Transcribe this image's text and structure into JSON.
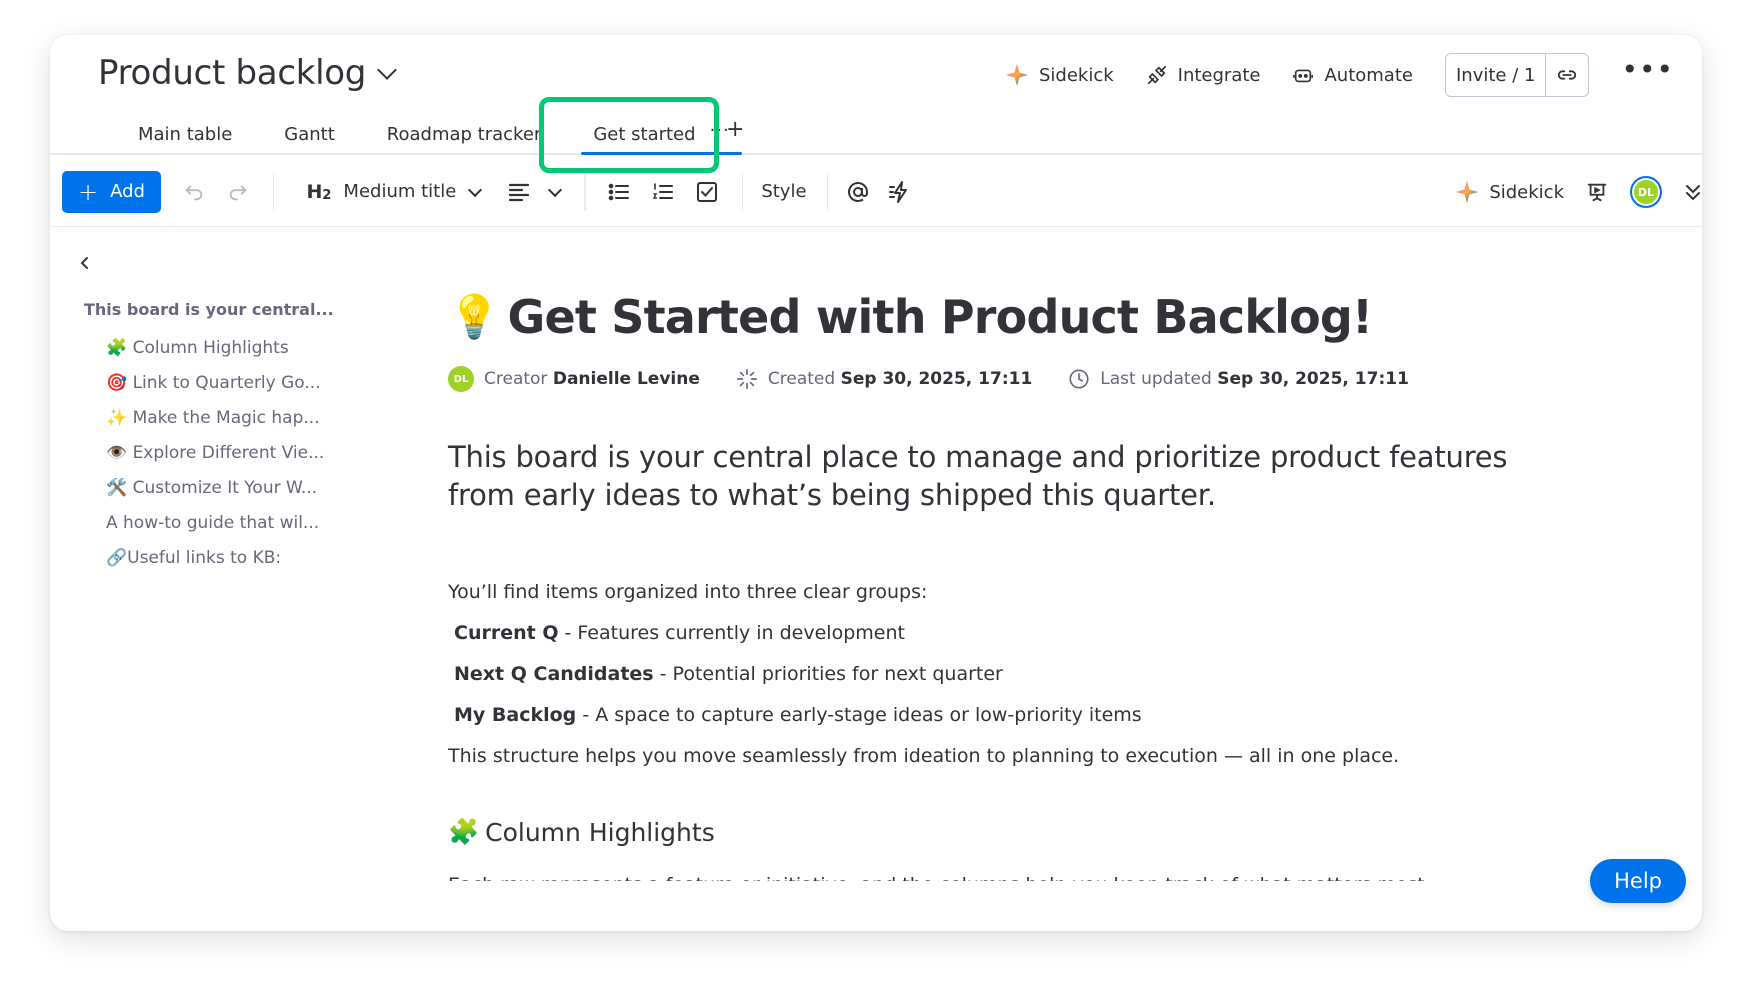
{
  "header": {
    "title": "Product backlog",
    "actions": {
      "sidekick": "Sidekick",
      "integrate": "Integrate",
      "automate": "Automate",
      "invite": "Invite / 1"
    }
  },
  "tabs": [
    {
      "label": "Main table"
    },
    {
      "label": "Gantt"
    },
    {
      "label": "Roadmap tracker"
    },
    {
      "label": "Get started",
      "active": true
    }
  ],
  "toolbar": {
    "add": "Add",
    "heading_level": "H",
    "heading_sub": "2",
    "heading_style": "Medium title",
    "style": "Style",
    "sidekick": "Sidekick",
    "avatar": "DL"
  },
  "outline": {
    "heading": "This board is your central...",
    "items": [
      "🧩 Column Highlights",
      "🎯 Link to Quarterly Go...",
      "✨ Make the Magic hap...",
      "👁️ Explore Different Vie...",
      "🛠️ Customize It Your W...",
      "A how-to guide that wil...",
      "🔗Useful links to KB:"
    ]
  },
  "doc": {
    "emoji": "💡",
    "title": "Get Started with Product Backlog!",
    "meta": {
      "avatar": "DL",
      "creator_label": "Creator",
      "creator": "Danielle Levine",
      "created_label": "Created",
      "created": "Sep 30, 2025, 17:11",
      "updated_label": "Last updated",
      "updated": "Sep 30, 2025, 17:11"
    },
    "lead": "This board is your central place to manage and prioritize product features from early ideas to what’s being shipped this quarter.",
    "intro": "You’ll find items organized into three clear groups:",
    "groups": [
      {
        "name": "Current Q",
        "desc": " - Features currently in development"
      },
      {
        "name": "Next Q Candidates",
        "desc": " - Potential priorities for next quarter"
      },
      {
        "name": "My Backlog",
        "desc": " - A space to capture early-stage ideas or low-priority items"
      }
    ],
    "outro": "This structure helps you move seamlessly from ideation to planning to execution — all in one place.",
    "section_emoji": "🧩",
    "section_title": "Column Highlights",
    "section_text": "Each row represents a feature or initiative, and the columns help you keep track of what matters most:"
  },
  "help": "Help",
  "colors": {
    "primary": "#0073ea",
    "highlight": "#00c875",
    "avatar": "#9cd326"
  }
}
